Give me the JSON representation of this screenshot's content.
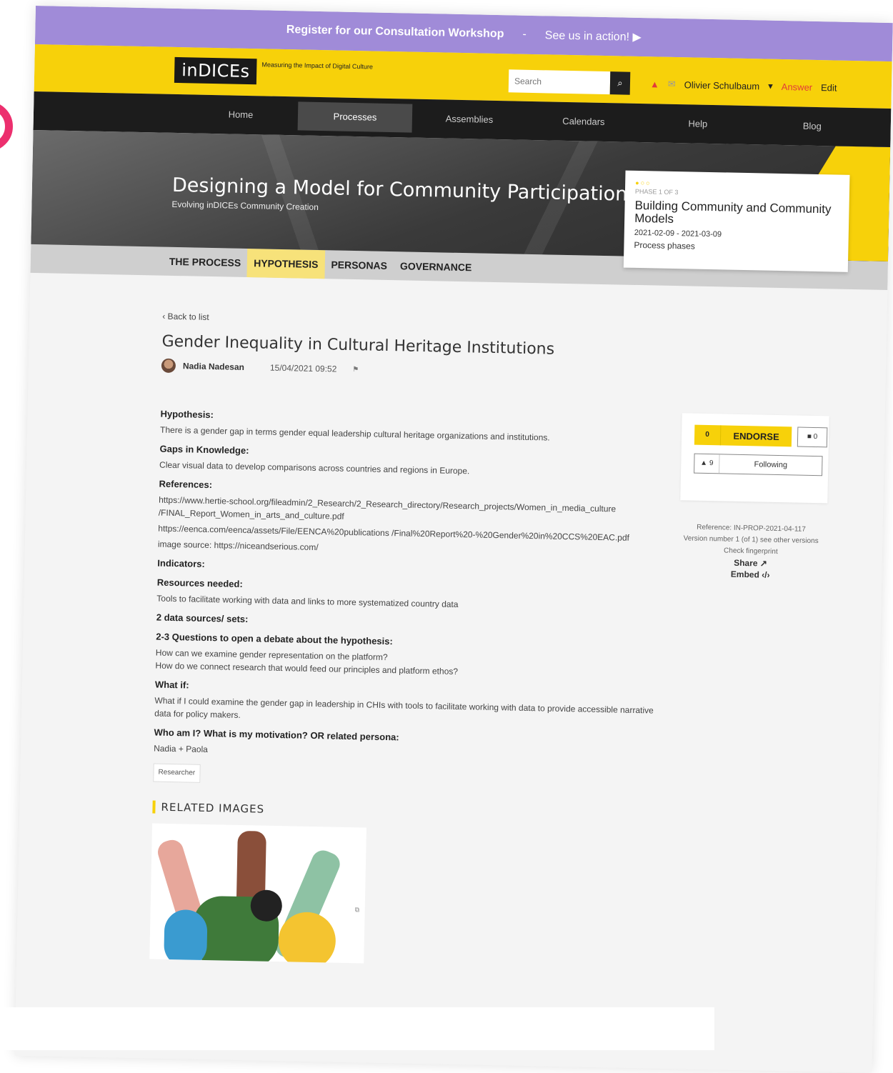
{
  "announce": {
    "workshop": "Register for our Consultation Workshop",
    "separator": "-",
    "action": "See us in action! ▶"
  },
  "header": {
    "logo": "inDICEs",
    "tagline": "Measuring the Impact of Digital Culture",
    "search_placeholder": "Search",
    "user": "Olivier Schulbaum",
    "answer": "Answer",
    "edit": "Edit"
  },
  "nav": [
    "Home",
    "Processes",
    "Assemblies",
    "Calendars",
    "Help",
    "Blog"
  ],
  "hero": {
    "title": "Designing a Model for Community Participation",
    "subtitle": "Evolving inDICEs Community Creation"
  },
  "phase": {
    "label": "PHASE 1 OF 3",
    "title": "Building Community and Community Models",
    "dates": "2021-02-09 - 2021-03-09",
    "link": "Process phases"
  },
  "subnav": [
    "THE PROCESS",
    "HYPOTHESIS",
    "PERSONAS",
    "GOVERNANCE"
  ],
  "proposal": {
    "back": "‹ Back to list",
    "title": "Gender Inequality in Cultural Heritage Institutions",
    "author": "Nadia Nadesan",
    "date": "15/04/2021 09:52"
  },
  "body": {
    "hypothesis_h": "Hypothesis:",
    "hypothesis_p": "There is a gender gap in terms gender equal leadership cultural heritage organizations and institutions.",
    "gaps_h": "Gaps in Knowledge:",
    "gaps_p": "Clear visual data to develop comparisons across countries and regions in Europe.",
    "references_h": "References:",
    "ref1": "https://www.hertie-school.org/fileadmin/2_Research/2_Research_directory/Research_projects/Women_in_media_culture /FINAL_Report_Women_in_arts_and_culture.pdf",
    "ref2": "https://eenca.com/eenca/assets/File/EENCA%20publications /Final%20Report%20-%20Gender%20in%20CCS%20EAC.pdf",
    "ref3": "image source: https://niceandserious.com/",
    "indicators_h": "Indicators:",
    "resources_h": "Resources needed:",
    "resources_p": "Tools to facilitate working with data and links to more systematized country data",
    "data_h": "2 data sources/ sets:",
    "questions_h": "2-3 Questions to open a debate about the hypothesis:",
    "q1": "How can we examine gender representation on the platform?",
    "q2": "How do we connect research that would feed our principles and platform ethos?",
    "whatif_h": "What if:",
    "whatif_p": "What if I could examine the gender gap in leadership in CHIs with tools to facilitate working with data to provide accessible narrative data for policy makers.",
    "who_h": "Who am I? What is my motivation? OR related persona:",
    "who_p": "Nadia + Paola",
    "tag": "Researcher",
    "related_h": "RELATED IMAGES"
  },
  "sidebar": {
    "endorse_count": "0",
    "endorse_label": "ENDORSE",
    "comment_count": "0",
    "follow_count": "9",
    "follow_label": "Following",
    "reference": "Reference: IN-PROP-2021-04-117",
    "version": "Version number 1 (of 1) see other versions",
    "fingerprint": "Check fingerprint",
    "share": "Share ↗",
    "embed": "Embed ‹/›"
  },
  "colors": {
    "purple": "#a08bd8",
    "yellow": "#f7d10a",
    "dark": "#1c1c1c"
  }
}
